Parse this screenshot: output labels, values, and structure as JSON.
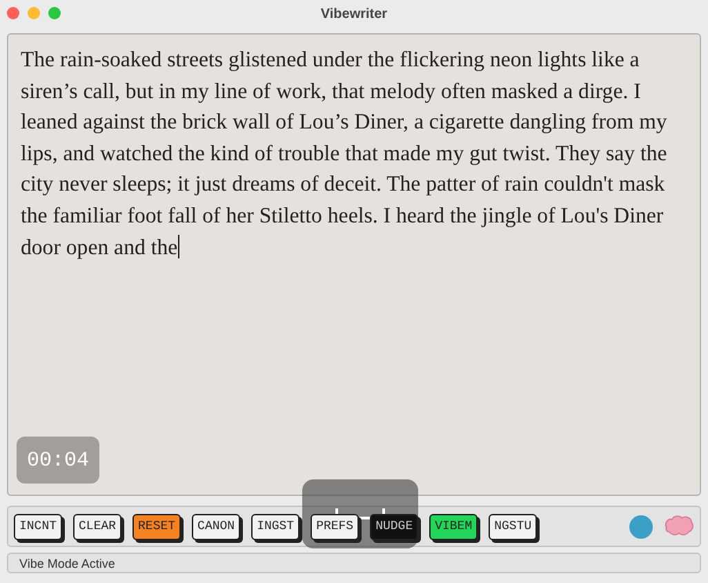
{
  "window": {
    "title": "Vibewriter"
  },
  "editor": {
    "text": "The rain-soaked streets glistened under the flickering neon lights like a siren’s call, but in my line of work, that melody often masked a dirge. I leaned against the brick wall of Lou’s Diner, a cigarette dangling from my lips, and watched the kind of trouble that made my gut twist. They say the city never sleeps; it just dreams of deceit. The patter of rain couldn't mask the familiar foot fall of her Stiletto heels. I heard the jingle of Lou's Diner door open and the",
    "timer": "00:04"
  },
  "toolbar": {
    "buttons": [
      {
        "label": "INCNT",
        "color": "#f2f2f2"
      },
      {
        "label": "CLEAR",
        "color": "#f2f2f2"
      },
      {
        "label": "RESET",
        "color": "#f5821f"
      },
      {
        "label": "CANON",
        "color": "#f2f2f2"
      },
      {
        "label": "INGST",
        "color": "#f2f2f2"
      },
      {
        "label": "PREFS",
        "color": "#f2f2f2"
      },
      {
        "label": "NUDGE",
        "color": "#111111"
      },
      {
        "label": "VIBEM",
        "color": "#22d65a"
      },
      {
        "label": "NGSTU",
        "color": "#f2f2f2"
      }
    ]
  },
  "status_bar": {
    "text": "Vibe Mode Active"
  }
}
